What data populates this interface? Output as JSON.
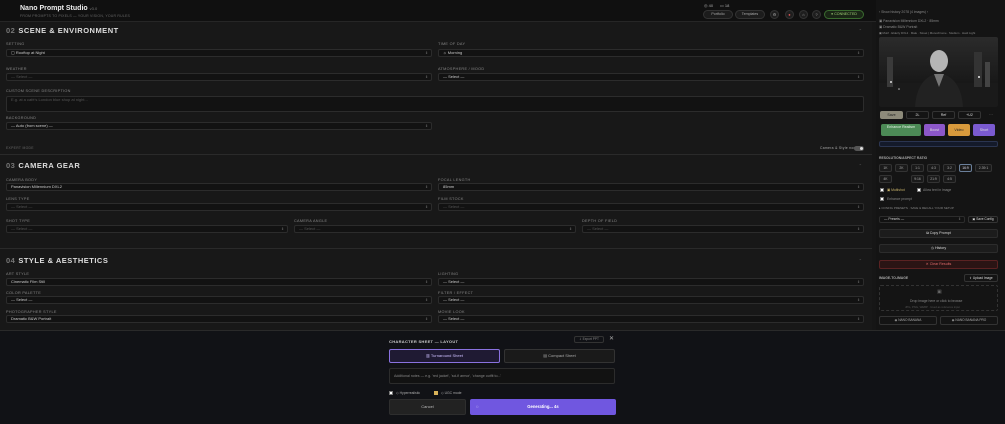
{
  "header": {
    "title": "Nano Prompt Studio",
    "version": "v3.0",
    "tagline": "FROM PROMPTS TO PIXELS — YOUR VISION, YOUR RULES",
    "credits": "40",
    "count": "18",
    "portfolio": "Portfolio",
    "templates": "Templates",
    "connected": "CONNECTED"
  },
  "scene": {
    "num": "02",
    "title": "SCENE & ENVIRONMENT",
    "setting_label": "SETTING",
    "setting_value": "Rooftop at Night",
    "time_label": "TIME OF DAY",
    "time_value": "Morning",
    "weather_label": "WEATHER",
    "weather_value": "— Select —",
    "atmo_label": "ATMOSPHERE / MOOD",
    "atmo_value": "— Select —",
    "custom_label": "CUSTOM SCENE DESCRIPTION",
    "custom_placeholder": "E.g. at a café's London blue shop at night...",
    "bg_label": "BACKGROUND",
    "bg_value": "— Auto (from scene) —",
    "expert": "EXPERT MODE",
    "camera_toggle": "Camera & Style nodes"
  },
  "camera": {
    "num": "03",
    "title": "CAMERA GEAR",
    "body_label": "CAMERA BODY",
    "body_value": "Panavision Millennium DXL2",
    "focal_label": "FOCAL LENGTH",
    "focal_value": "85mm",
    "lens_label": "LENS TYPE",
    "lens_value": "— Select —",
    "film_label": "FILM STOCK",
    "film_value": "— Select —",
    "shot_label": "SHOT TYPE",
    "shot_value": "— Select —",
    "angle_label": "CAMERA ANGLE",
    "angle_value": "— Select —",
    "dof_label": "DEPTH OF FIELD",
    "dof_value": "— Select —"
  },
  "style": {
    "num": "04",
    "title": "STYLE & AESTHETICS",
    "art_label": "ART STYLE",
    "art_value": "Cinematic Film Still",
    "light_label": "LIGHTING",
    "light_value": "— Select —",
    "palette_label": "COLOR PALETTE",
    "palette_value": "— Select —",
    "filter_label": "FILTER / EFFECT",
    "filter_value": "— Select —",
    "photo_label": "PHOTOGRAPHER STYLE",
    "photo_value": "Dramatic B&W Portrait",
    "movie_label": "MOVIE LOOK",
    "movie_value": "— Select —"
  },
  "right": {
    "top_line": "Show history 2078 (4 images)",
    "meta1": "Panavision Millennium DXL2 · 85mm",
    "meta2": "Dramatic B&W Portrait",
    "meta3": "Motif · Elderly DXL2 · Male · Street | Monochrome · Medium · Hard Light",
    "chips": [
      "Save",
      "2L",
      "Ref",
      "+U2"
    ],
    "enhance": "Enhance Realism",
    "boost": "Boost",
    "video": "Video",
    "short": "Short",
    "res_label": "RESOLUTION/ASPECT RATIO",
    "ratios": [
      "1K",
      "2K",
      "1:1",
      "4:3",
      "3:2",
      "16:9",
      "2.39:1",
      "4K",
      "9:16",
      "21:9",
      "4:5"
    ],
    "multishot": "Multishot",
    "allow_text": "Allow text in image",
    "enhance_prompt": "Enhance prompt",
    "presets_label": "CONFIG PRESETS",
    "presets_sub": "SAVE & RECALL YOUR SETUP",
    "presets_value": "— Presets —",
    "save_config": "Save Config",
    "copy": "Copy Prompt",
    "history": "History",
    "clear": "Clear Results",
    "i2i": "IMAGE-TO-IMAGE",
    "upload": "Upload Image",
    "drop": "Drop image here or click to browse",
    "drop_sub": "JPG, PNG, WEBP · Used as reference input",
    "nb": "NANO BANANA",
    "nbp": "NANO BANANA PRO"
  },
  "dialog": {
    "title": "CHARACTER SHEET — LAYOUT",
    "export": "Export PPT",
    "turnaround": "Turnaround Sheet",
    "compact": "Compact Sheet",
    "notes_placeholder": "Additional notes — e.g. 'red jacket', 'sci-fi armor', 'change outfit to...'",
    "hyper": "Hyperrealistic",
    "ugc": "UGC mode",
    "cancel": "Cancel",
    "generating": "Generating... 4s"
  }
}
